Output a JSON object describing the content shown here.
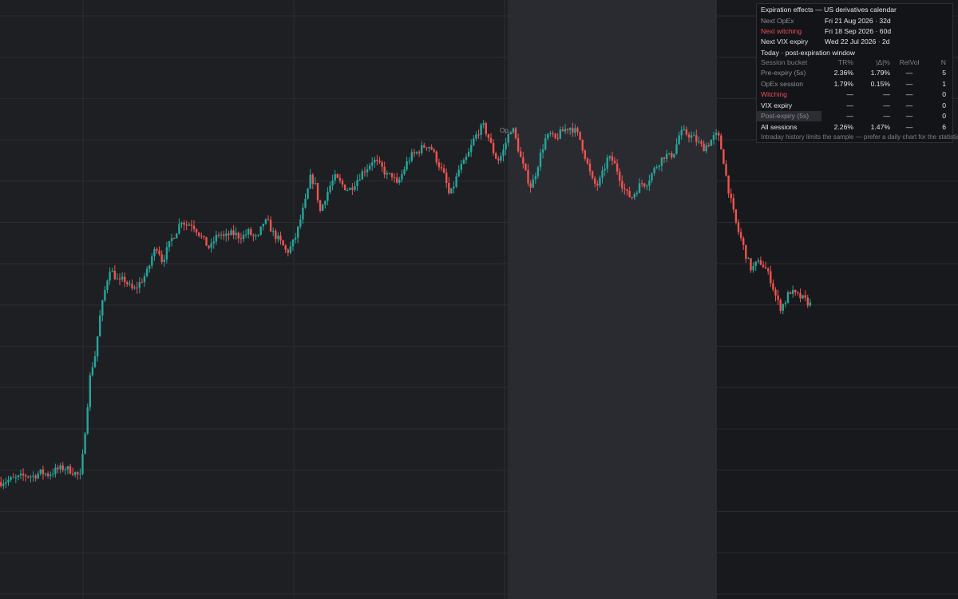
{
  "chart_data": {
    "type": "candlestick",
    "colors": {
      "up": "#26a69a",
      "down": "#ef5350",
      "background": "#1e1f23",
      "highlight_band": "#2a2b30",
      "grid": "#2b2c31"
    },
    "grid": true,
    "marker_label": "Op",
    "y_range": [
      0,
      100
    ],
    "price_path": [
      [
        0,
        14.4
      ],
      [
        10,
        14.9
      ],
      [
        20,
        15.3
      ],
      [
        30,
        16.0
      ],
      [
        40,
        15.8
      ],
      [
        50,
        16.7
      ],
      [
        60,
        16.2
      ],
      [
        70,
        17.4
      ],
      [
        80,
        17.8
      ],
      [
        90,
        16.9
      ],
      [
        100,
        15.6
      ],
      [
        106,
        28.0
      ],
      [
        112,
        40.0
      ],
      [
        118,
        44.5
      ],
      [
        124,
        53.5
      ],
      [
        130,
        59.5
      ],
      [
        136,
        65.0
      ],
      [
        142,
        63.2
      ],
      [
        148,
        61.5
      ],
      [
        154,
        62.4
      ],
      [
        160,
        60.8
      ],
      [
        166,
        59.6
      ],
      [
        172,
        61.0
      ],
      [
        178,
        62.5
      ],
      [
        184,
        64.3
      ],
      [
        190,
        68.3
      ],
      [
        196,
        70.2
      ],
      [
        202,
        66.6
      ],
      [
        208,
        69.3
      ],
      [
        214,
        71.9
      ],
      [
        220,
        73.8
      ],
      [
        226,
        76.4
      ],
      [
        232,
        75.1
      ],
      [
        238,
        75.6
      ],
      [
        244,
        74.3
      ],
      [
        250,
        72.6
      ],
      [
        256,
        70.9
      ],
      [
        262,
        69.5
      ],
      [
        268,
        71.9
      ],
      [
        274,
        73.3
      ],
      [
        280,
        72.1
      ],
      [
        286,
        73.0
      ],
      [
        292,
        73.1
      ],
      [
        298,
        72.5
      ],
      [
        304,
        72.6
      ],
      [
        310,
        73.5
      ],
      [
        316,
        72.4
      ],
      [
        322,
        71.9
      ],
      [
        328,
        75.6
      ],
      [
        334,
        75.9
      ],
      [
        340,
        73.4
      ],
      [
        346,
        72.1
      ],
      [
        352,
        70.6
      ],
      [
        358,
        68.6
      ],
      [
        364,
        70.2
      ],
      [
        370,
        72.8
      ],
      [
        376,
        77.1
      ],
      [
        382,
        81.1
      ],
      [
        388,
        86.7
      ],
      [
        394,
        84.3
      ],
      [
        400,
        78.3
      ],
      [
        406,
        81.6
      ],
      [
        412,
        84.3
      ],
      [
        418,
        86.4
      ],
      [
        424,
        85.3
      ],
      [
        430,
        84.2
      ],
      [
        436,
        83.4
      ],
      [
        442,
        84.8
      ],
      [
        448,
        86.4
      ],
      [
        454,
        87.9
      ],
      [
        460,
        89.0
      ],
      [
        466,
        90.6
      ],
      [
        472,
        89.6
      ],
      [
        478,
        88.4
      ],
      [
        484,
        86.7
      ],
      [
        490,
        87.0
      ],
      [
        496,
        84.5
      ],
      [
        502,
        87.0
      ],
      [
        508,
        89.7
      ],
      [
        514,
        91.5
      ],
      [
        520,
        92.1
      ],
      [
        526,
        93.2
      ],
      [
        532,
        94.0
      ],
      [
        538,
        93.7
      ],
      [
        544,
        91.3
      ],
      [
        550,
        88.8
      ],
      [
        556,
        86.4
      ],
      [
        562,
        81.8
      ],
      [
        568,
        84.9
      ],
      [
        574,
        88.4
      ],
      [
        580,
        89.8
      ],
      [
        586,
        92.1
      ],
      [
        592,
        95.2
      ],
      [
        598,
        97.2
      ],
      [
        604,
        98.6
      ],
      [
        610,
        96.2
      ],
      [
        616,
        92.8
      ],
      [
        622,
        90.3
      ],
      [
        628,
        92.0
      ],
      [
        634,
        95.6
      ],
      [
        640,
        98.5
      ],
      [
        646,
        94.6
      ],
      [
        652,
        90.2
      ],
      [
        658,
        86.9
      ],
      [
        664,
        84.1
      ],
      [
        670,
        87.6
      ],
      [
        676,
        91.9
      ],
      [
        682,
        95.4
      ],
      [
        688,
        96.5
      ],
      [
        694,
        95.3
      ],
      [
        700,
        96.7
      ],
      [
        706,
        97.7
      ],
      [
        712,
        98.3
      ],
      [
        718,
        97.6
      ],
      [
        724,
        96.2
      ],
      [
        730,
        92.6
      ],
      [
        736,
        88.5
      ],
      [
        742,
        84.9
      ],
      [
        748,
        84.6
      ],
      [
        754,
        87.5
      ],
      [
        760,
        90.9
      ],
      [
        766,
        90.4
      ],
      [
        772,
        88.1
      ],
      [
        778,
        84.7
      ],
      [
        784,
        82.5
      ],
      [
        790,
        81.6
      ],
      [
        796,
        83.4
      ],
      [
        802,
        85.1
      ],
      [
        808,
        84.9
      ],
      [
        814,
        86.8
      ],
      [
        820,
        88.8
      ],
      [
        826,
        90.4
      ],
      [
        832,
        91.8
      ],
      [
        838,
        91.2
      ],
      [
        844,
        92.7
      ],
      [
        850,
        96.7
      ],
      [
        856,
        97.0
      ],
      [
        862,
        96.4
      ],
      [
        868,
        95.7
      ],
      [
        874,
        94.5
      ],
      [
        880,
        93.4
      ],
      [
        886,
        94.3
      ],
      [
        892,
        95.8
      ],
      [
        898,
        96.5
      ],
      [
        904,
        91.7
      ],
      [
        910,
        84.7
      ],
      [
        916,
        79.3
      ],
      [
        922,
        74.5
      ],
      [
        928,
        71.3
      ],
      [
        934,
        67.5
      ],
      [
        940,
        64.6
      ],
      [
        946,
        66.0
      ],
      [
        952,
        66.3
      ],
      [
        958,
        64.7
      ],
      [
        964,
        62.3
      ],
      [
        970,
        58.6
      ],
      [
        976,
        55.6
      ],
      [
        982,
        56.9
      ],
      [
        988,
        59.6
      ],
      [
        994,
        58.8
      ],
      [
        1000,
        58.2
      ],
      [
        1006,
        57.6
      ],
      [
        1012,
        56.6
      ],
      [
        1016,
        56.2
      ]
    ]
  },
  "panel": {
    "title": "Expiration effects — US derivatives calendar",
    "next_opex_label": "Next OpEx",
    "next_opex_value": "Fri 21 Aug 2026 · 32d",
    "next_witching_label": "Next witching",
    "next_witching_value": "Fri 18 Sep 2026 · 60d",
    "next_vix_label": "Next VIX expiry",
    "next_vix_value": "Wed 22 Jul 2026 · 2d",
    "mode": "Today · post-expiration window",
    "headers": [
      "Session bucket",
      "TR%",
      "|Δ|%",
      "RelVol",
      "N"
    ],
    "rows": [
      [
        "Pre-expiry (5s)",
        "2.36%",
        "1.79%",
        "—",
        "5"
      ],
      [
        "OpEx session",
        "1.79%",
        "0.15%",
        "—",
        "1"
      ],
      [
        "Witching",
        "—",
        "—",
        "—",
        "0"
      ],
      [
        "VIX expiry",
        "—",
        "—",
        "—",
        "0"
      ],
      [
        "Post-expiry (5s)",
        "—",
        "—",
        "—",
        "0"
      ],
      [
        "All sessions",
        "2.26%",
        "1.47%",
        "—",
        "6"
      ]
    ],
    "note": "Intraday history limits the sample — prefer a daily chart for the statistics"
  }
}
